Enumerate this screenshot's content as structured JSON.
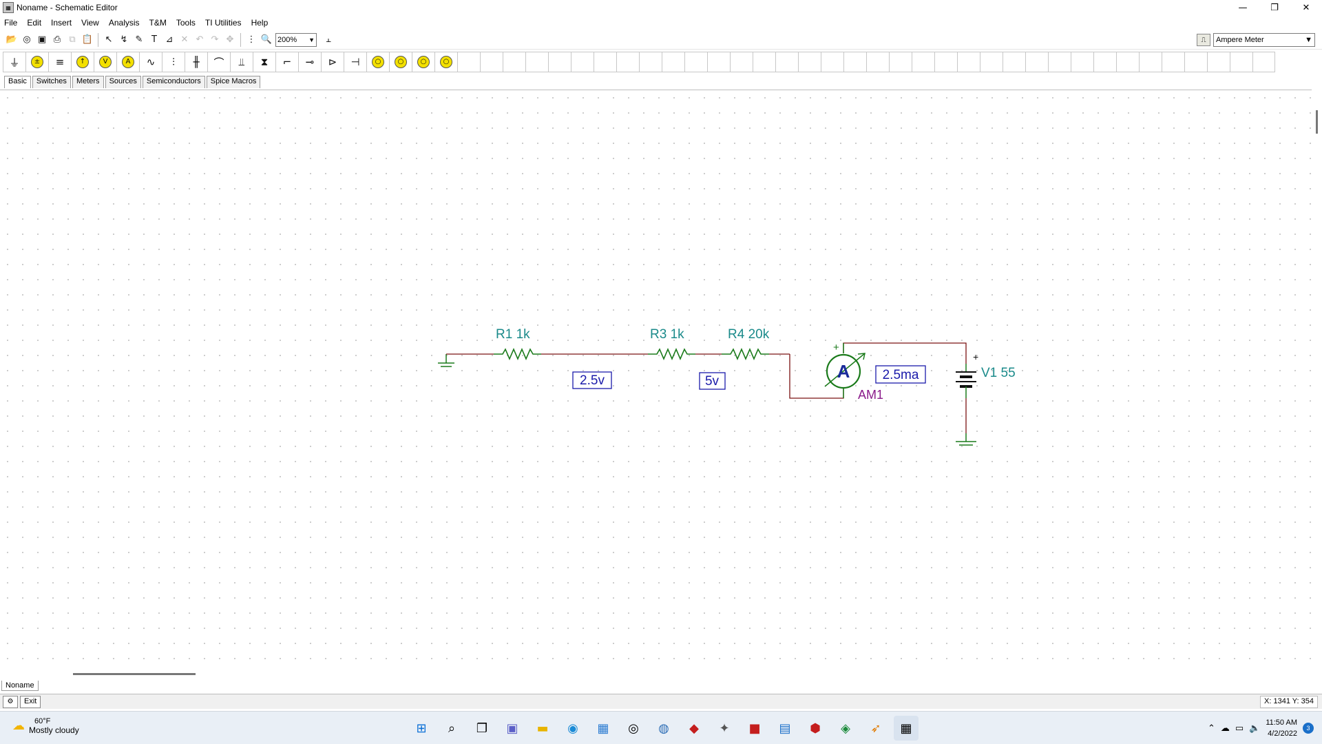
{
  "window": {
    "title": "Noname - Schematic Editor",
    "min": "—",
    "max": "❐",
    "close": "✕"
  },
  "menu": [
    "File",
    "Edit",
    "Insert",
    "View",
    "Analysis",
    "T&M",
    "Tools",
    "TI Utilities",
    "Help"
  ],
  "toolbar": {
    "zoom": "200%",
    "component_select": "Ampere Meter"
  },
  "tabs": [
    "Basic",
    "Switches",
    "Meters",
    "Sources",
    "Semiconductors",
    "Spice Macros"
  ],
  "active_tab": "Basic",
  "schematic": {
    "r1_label": "R1 1k",
    "r3_label": "R3 1k",
    "r4_label": "R4 20k",
    "v1_label": "V1 55",
    "am1_label": "AM1",
    "ammeter_symbol": "A",
    "plus": "+",
    "probe_1": "2.5v",
    "probe_2": "5v",
    "probe_3": "2.5ma"
  },
  "document_tab": "Noname",
  "status": {
    "exit": "Exit",
    "coords": "X: 1341  Y: 354"
  },
  "taskbar": {
    "temp": "60°F",
    "condition": "Mostly cloudy",
    "time": "11:50 AM",
    "date": "4/2/2022",
    "notifications": "3"
  }
}
